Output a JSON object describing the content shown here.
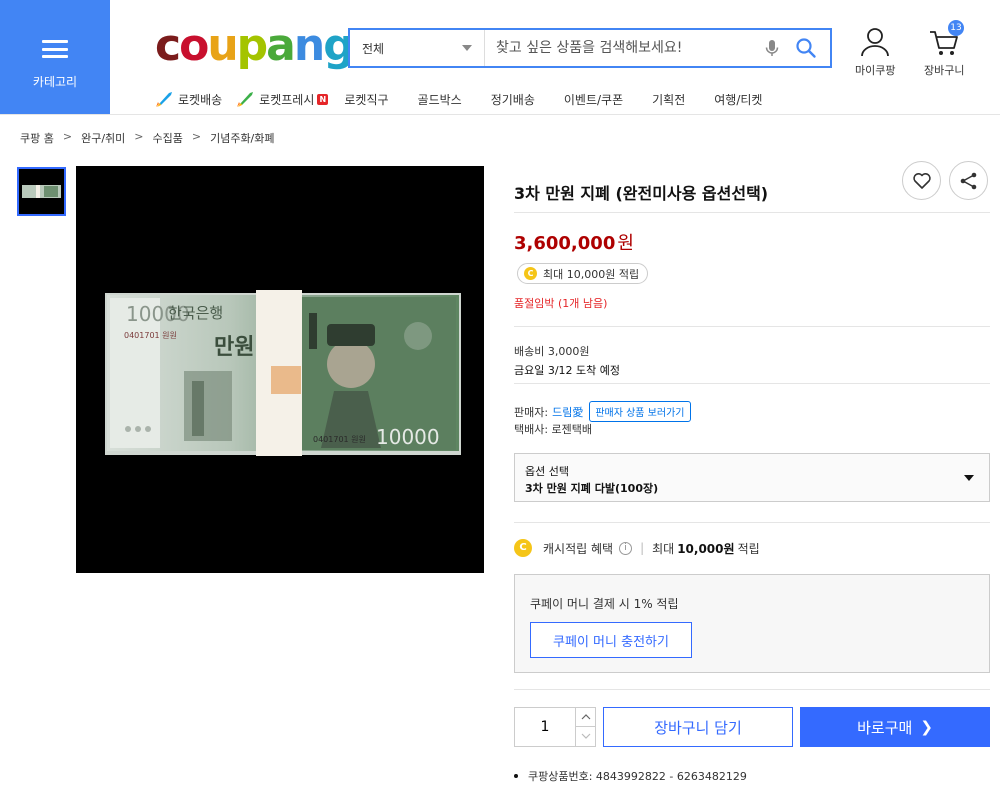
{
  "header": {
    "category_label": "카테고리",
    "logo_letters": [
      {
        "ch": "c",
        "color": "#7b1c1c"
      },
      {
        "ch": "o",
        "color": "#c8102e"
      },
      {
        "ch": "u",
        "color": "#e8a317"
      },
      {
        "ch": "p",
        "color": "#a4c400"
      },
      {
        "ch": "a",
        "color": "#4aa93a"
      },
      {
        "ch": "n",
        "color": "#3c8be0"
      },
      {
        "ch": "g",
        "color": "#1fa3c7"
      }
    ],
    "search_scope": "전체",
    "search_placeholder": "찾고 싶은 상품을 검색해보세요!",
    "mypage_label": "마이쿠팡",
    "cart_label": "장바구니",
    "cart_count": "13",
    "accent_color": "#4285f4"
  },
  "subnav": {
    "rocket_delivery": "로켓배송",
    "rocket_fresh": "로켓프레시",
    "new_badge": "N",
    "items": [
      "로켓직구",
      "골드박스",
      "정기배송",
      "이벤트/쿠폰",
      "기획전",
      "여행/티켓"
    ]
  },
  "breadcrumb": [
    "쿠팡 홈",
    "완구/취미",
    "수집품",
    "기념주화/화폐"
  ],
  "breadcrumb_separator": ">",
  "banknote": {
    "denomination": "10000",
    "korean_text": "한국은행",
    "won_mark": "만원",
    "serial": "0401701 원원",
    "note_color": "#5e8561"
  },
  "product": {
    "title": "3차 만원 지폐 (완전미사용 옵션선택)",
    "price": "3,600,000",
    "price_unit": "원",
    "reward": "최대 10,000원 적립",
    "coin_symbol": "C",
    "stock_notice": "품절임박 (1개 남음)",
    "shipping_fee": "배송비 3,000원",
    "arrival": "금요일 3/12 도착 예정",
    "seller_label": "판매자:",
    "seller_name": "드림愛",
    "seller_more": "판매자 상품 보러가기",
    "courier": "택배사: 로젠택배",
    "option_label": "옵션 선택",
    "option_value": "3차 만원 지폐 다발(100장)",
    "cash_benefit_label": "캐시적립 혜택",
    "cash_benefit_prefix": "최대",
    "cash_benefit_amount": "10,000원",
    "cash_benefit_suffix": "적립",
    "coupay_desc": "쿠페이 머니 결제 시 1% 적립",
    "coupay_button": "쿠페이 머니 충전하기",
    "quantity": "1",
    "add_to_cart": "장바구니 담기",
    "buy_now": "바로구매",
    "product_number": "쿠팡상품번호: 4843992822 - 6263482129",
    "price_color": "#ae0000",
    "button_color": "#346aff"
  }
}
